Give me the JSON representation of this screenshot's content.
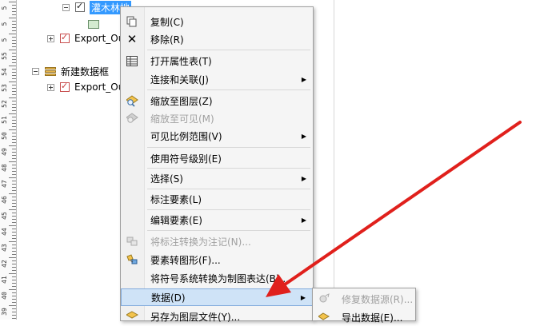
{
  "ruler": {
    "labels": [
      "5",
      "5",
      "5",
      "55",
      "54",
      "53",
      "52",
      "51",
      "50",
      "49",
      "48",
      "47",
      "46",
      "45",
      "44",
      "43",
      "42",
      "41",
      "40",
      "39"
    ]
  },
  "toc": {
    "layers": [
      {
        "name": "灌木林地",
        "checked": true,
        "selected": true
      },
      {
        "name": "Export_Ou",
        "checked": true
      },
      {
        "name": "新建数据框"
      },
      {
        "name": "Export_Ou",
        "checked": true
      }
    ]
  },
  "context_menu": {
    "items": [
      {
        "label": "复制(C)",
        "icon": "copy-icon",
        "enabled": true
      },
      {
        "label": "移除(R)",
        "icon": "remove-x-icon",
        "enabled": true
      },
      {
        "label": "打开属性表(T)",
        "icon": "table-icon",
        "enabled": true
      },
      {
        "label": "连接和关联(J)",
        "submenu": true,
        "enabled": true
      },
      {
        "label": "缩放至图层(Z)",
        "icon": "zoom-layer-icon",
        "enabled": true
      },
      {
        "label": "缩放至可见(M)",
        "icon": "zoom-visible-icon",
        "enabled": false
      },
      {
        "label": "可见比例范围(V)",
        "submenu": true,
        "enabled": true
      },
      {
        "label": "使用符号级别(E)",
        "enabled": true
      },
      {
        "label": "选择(S)",
        "submenu": true,
        "enabled": true
      },
      {
        "label": "标注要素(L)",
        "enabled": true
      },
      {
        "label": "编辑要素(E)",
        "submenu": true,
        "enabled": true
      },
      {
        "label": "将标注转换为注记(N)...",
        "icon": "convert-labels-icon",
        "enabled": false
      },
      {
        "label": "要素转图形(F)...",
        "icon": "features-to-graphics-icon",
        "enabled": true
      },
      {
        "label": "将符号系统转换为制图表达(B)...",
        "enabled": true
      },
      {
        "label": "数据(D)",
        "submenu": true,
        "enabled": true,
        "highlighted": true
      },
      {
        "label": "另存为图层文件(Y)...",
        "icon": "save-layer-icon",
        "enabled": true
      }
    ]
  },
  "data_submenu": {
    "items": [
      {
        "label": "修复数据源(R)...",
        "icon": "repair-source-icon",
        "enabled": false
      },
      {
        "label": "导出数据(E)...",
        "icon": "export-data-icon",
        "enabled": true
      }
    ]
  },
  "colors": {
    "arrow": "#e0201c",
    "selection": "#3399ff",
    "menu_highlight": "#cfe3f7"
  }
}
